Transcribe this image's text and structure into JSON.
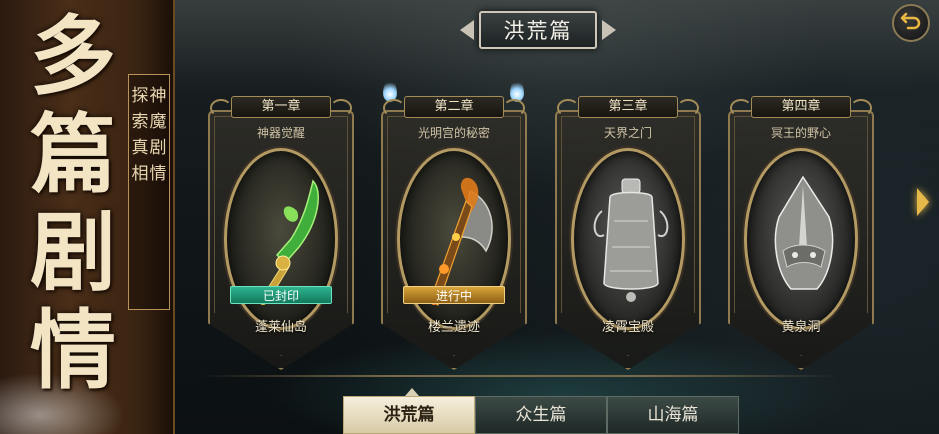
{
  "banner": {
    "title_chars": [
      "多",
      "篇",
      "剧",
      "情"
    ],
    "subtitle_col1": [
      "神",
      "魔",
      "剧",
      "情"
    ],
    "subtitle_col2": [
      "探",
      "索",
      "真",
      "相"
    ]
  },
  "header": {
    "title": "洪荒篇"
  },
  "chapters": [
    {
      "chapter": "第一章",
      "subtitle": "神器觉醒",
      "status": "已封印",
      "place": "蓬莱仙岛"
    },
    {
      "chapter": "第二章",
      "subtitle": "光明宫的秘密",
      "status": "进行中",
      "place": "楼兰遗迹"
    },
    {
      "chapter": "第三章",
      "subtitle": "天界之门",
      "status": "",
      "place": "凌霄宝殿"
    },
    {
      "chapter": "第四章",
      "subtitle": "冥王的野心",
      "status": "",
      "place": "黄泉洞"
    }
  ],
  "tabs": [
    "洪荒篇",
    "众生篇",
    "山海篇"
  ],
  "active_tab": "洪荒篇",
  "icons": {
    "back": "back-arrow-icon",
    "next": "chevron-right-icon",
    "weapon1": "jade-sword-icon",
    "weapon2": "flame-axe-icon",
    "item3": "bell-icon",
    "item4": "helmet-icon"
  },
  "colors": {
    "sealed": "#2fb38f",
    "in_progress": "#d9a43a",
    "gold": "#e6b84a"
  }
}
